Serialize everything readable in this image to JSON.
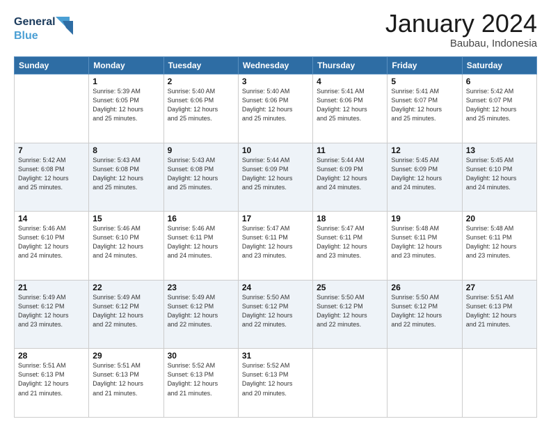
{
  "logo": {
    "text_general": "General",
    "text_blue": "Blue"
  },
  "title": "January 2024",
  "subtitle": "Baubau, Indonesia",
  "days_header": [
    "Sunday",
    "Monday",
    "Tuesday",
    "Wednesday",
    "Thursday",
    "Friday",
    "Saturday"
  ],
  "weeks": [
    {
      "shaded": false,
      "days": [
        {
          "num": "",
          "info": ""
        },
        {
          "num": "1",
          "info": "Sunrise: 5:39 AM\nSunset: 6:05 PM\nDaylight: 12 hours\nand 25 minutes."
        },
        {
          "num": "2",
          "info": "Sunrise: 5:40 AM\nSunset: 6:06 PM\nDaylight: 12 hours\nand 25 minutes."
        },
        {
          "num": "3",
          "info": "Sunrise: 5:40 AM\nSunset: 6:06 PM\nDaylight: 12 hours\nand 25 minutes."
        },
        {
          "num": "4",
          "info": "Sunrise: 5:41 AM\nSunset: 6:06 PM\nDaylight: 12 hours\nand 25 minutes."
        },
        {
          "num": "5",
          "info": "Sunrise: 5:41 AM\nSunset: 6:07 PM\nDaylight: 12 hours\nand 25 minutes."
        },
        {
          "num": "6",
          "info": "Sunrise: 5:42 AM\nSunset: 6:07 PM\nDaylight: 12 hours\nand 25 minutes."
        }
      ]
    },
    {
      "shaded": true,
      "days": [
        {
          "num": "7",
          "info": "Sunrise: 5:42 AM\nSunset: 6:08 PM\nDaylight: 12 hours\nand 25 minutes."
        },
        {
          "num": "8",
          "info": "Sunrise: 5:43 AM\nSunset: 6:08 PM\nDaylight: 12 hours\nand 25 minutes."
        },
        {
          "num": "9",
          "info": "Sunrise: 5:43 AM\nSunset: 6:08 PM\nDaylight: 12 hours\nand 25 minutes."
        },
        {
          "num": "10",
          "info": "Sunrise: 5:44 AM\nSunset: 6:09 PM\nDaylight: 12 hours\nand 25 minutes."
        },
        {
          "num": "11",
          "info": "Sunrise: 5:44 AM\nSunset: 6:09 PM\nDaylight: 12 hours\nand 24 minutes."
        },
        {
          "num": "12",
          "info": "Sunrise: 5:45 AM\nSunset: 6:09 PM\nDaylight: 12 hours\nand 24 minutes."
        },
        {
          "num": "13",
          "info": "Sunrise: 5:45 AM\nSunset: 6:10 PM\nDaylight: 12 hours\nand 24 minutes."
        }
      ]
    },
    {
      "shaded": false,
      "days": [
        {
          "num": "14",
          "info": "Sunrise: 5:46 AM\nSunset: 6:10 PM\nDaylight: 12 hours\nand 24 minutes."
        },
        {
          "num": "15",
          "info": "Sunrise: 5:46 AM\nSunset: 6:10 PM\nDaylight: 12 hours\nand 24 minutes."
        },
        {
          "num": "16",
          "info": "Sunrise: 5:46 AM\nSunset: 6:11 PM\nDaylight: 12 hours\nand 24 minutes."
        },
        {
          "num": "17",
          "info": "Sunrise: 5:47 AM\nSunset: 6:11 PM\nDaylight: 12 hours\nand 23 minutes."
        },
        {
          "num": "18",
          "info": "Sunrise: 5:47 AM\nSunset: 6:11 PM\nDaylight: 12 hours\nand 23 minutes."
        },
        {
          "num": "19",
          "info": "Sunrise: 5:48 AM\nSunset: 6:11 PM\nDaylight: 12 hours\nand 23 minutes."
        },
        {
          "num": "20",
          "info": "Sunrise: 5:48 AM\nSunset: 6:11 PM\nDaylight: 12 hours\nand 23 minutes."
        }
      ]
    },
    {
      "shaded": true,
      "days": [
        {
          "num": "21",
          "info": "Sunrise: 5:49 AM\nSunset: 6:12 PM\nDaylight: 12 hours\nand 23 minutes."
        },
        {
          "num": "22",
          "info": "Sunrise: 5:49 AM\nSunset: 6:12 PM\nDaylight: 12 hours\nand 22 minutes."
        },
        {
          "num": "23",
          "info": "Sunrise: 5:49 AM\nSunset: 6:12 PM\nDaylight: 12 hours\nand 22 minutes."
        },
        {
          "num": "24",
          "info": "Sunrise: 5:50 AM\nSunset: 6:12 PM\nDaylight: 12 hours\nand 22 minutes."
        },
        {
          "num": "25",
          "info": "Sunrise: 5:50 AM\nSunset: 6:12 PM\nDaylight: 12 hours\nand 22 minutes."
        },
        {
          "num": "26",
          "info": "Sunrise: 5:50 AM\nSunset: 6:12 PM\nDaylight: 12 hours\nand 22 minutes."
        },
        {
          "num": "27",
          "info": "Sunrise: 5:51 AM\nSunset: 6:13 PM\nDaylight: 12 hours\nand 21 minutes."
        }
      ]
    },
    {
      "shaded": false,
      "days": [
        {
          "num": "28",
          "info": "Sunrise: 5:51 AM\nSunset: 6:13 PM\nDaylight: 12 hours\nand 21 minutes."
        },
        {
          "num": "29",
          "info": "Sunrise: 5:51 AM\nSunset: 6:13 PM\nDaylight: 12 hours\nand 21 minutes."
        },
        {
          "num": "30",
          "info": "Sunrise: 5:52 AM\nSunset: 6:13 PM\nDaylight: 12 hours\nand 21 minutes."
        },
        {
          "num": "31",
          "info": "Sunrise: 5:52 AM\nSunset: 6:13 PM\nDaylight: 12 hours\nand 20 minutes."
        },
        {
          "num": "",
          "info": ""
        },
        {
          "num": "",
          "info": ""
        },
        {
          "num": "",
          "info": ""
        }
      ]
    }
  ]
}
